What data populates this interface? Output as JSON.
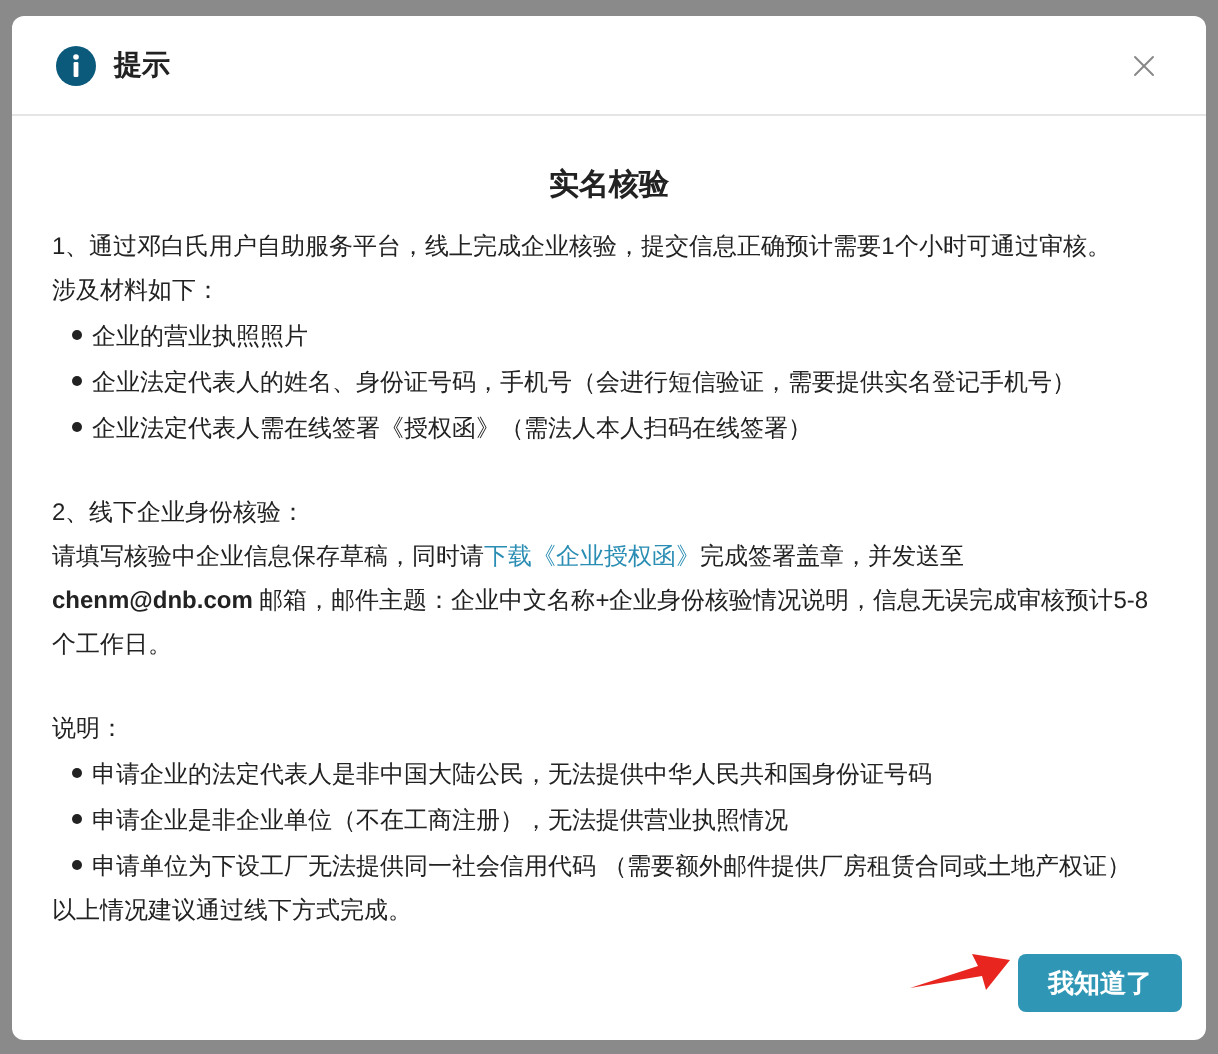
{
  "dialog": {
    "title": "提示"
  },
  "heading": "实名核验",
  "online": {
    "intro": "1、通过邓白氏用户自助服务平台，线上完成企业核验，提交信息正确预计需要1个小时可通过审核。",
    "materials_label": "涉及材料如下：",
    "bullets": [
      "企业的营业执照照片",
      "企业法定代表人的姓名、身份证号码，手机号（会进行短信验证，需要提供实名登记手机号）",
      "企业法定代表人需在线签署《授权函》（需法人本人扫码在线签署）"
    ]
  },
  "offline": {
    "heading": "2、线下企业身份核验：",
    "text_before": "请填写核验中企业信息保存草稿，同时请",
    "link": "下载《企业授权函》",
    "text_after": "完成签署盖章，并发送至 **chenm@dnb.com** 邮箱，邮件主题：企业中文名称+企业身份核验情况说明，信息无误完成审核预计5-8个工作日。"
  },
  "notes": {
    "label": "说明：",
    "bullets": [
      "申请企业的法定代表人是非中国大陆公民，无法提供中华人民共和国身份证号码",
      "申请企业是非企业单位（不在工商注册），无法提供营业执照情况",
      "申请单位为下设工厂无法提供同一社会信用代码 （需要额外邮件提供厂房租赁合同或土地产权证）"
    ],
    "conclusion": "以上情况建议通过线下方式完成。"
  },
  "confirm_button": "我知道了"
}
